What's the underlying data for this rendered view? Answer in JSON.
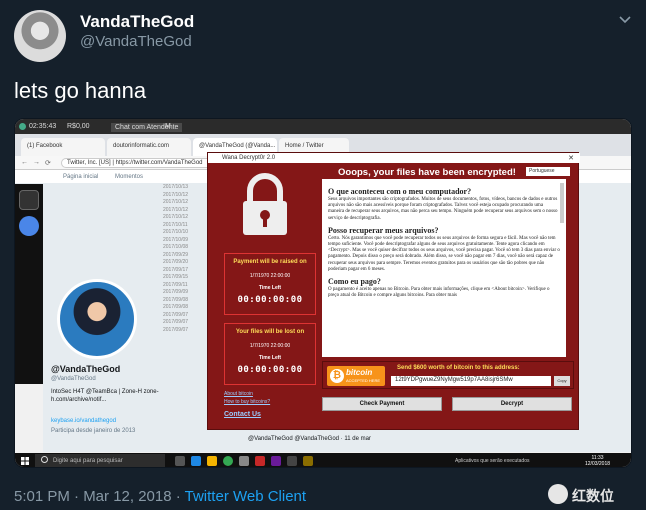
{
  "tweet": {
    "display_name": "VandaTheGod",
    "handle": "@VandaTheGod",
    "text": "lets go hanna",
    "timestamp": "5:01 PM · Mar 12, 2018 · ",
    "client": "Twitter Web Client",
    "watermark_text": "红数位"
  },
  "screenshot": {
    "topbar": {
      "time": "02:35:43",
      "price": "R$0,00",
      "tab1": "Chat com Atendente",
      "tab2": "M"
    },
    "browser_tabs": [
      "(1) Facebook",
      "doutorinformatic.com",
      "@VandaTheGod (@Vanda...",
      "Home / Twitter"
    ],
    "url": "Twitter, Inc. [US] | https://twitter.com/VandaTheGod",
    "twitter_nav": {
      "home": "Página inicial",
      "moments": "Momentos"
    },
    "dates": [
      "2017/10/13",
      "2017/10/12",
      "2017/10/12",
      "2017/10/12",
      "2017/10/12",
      "2017/10/11",
      "2017/10/10",
      "2017/10/09",
      "2017/10/08",
      "2017/09/29",
      "2017/09/20",
      "2017/09/17",
      "2017/09/15",
      "2017/09/11",
      "2017/09/09",
      "2017/09/08",
      "2017/09/08",
      "2017/09/07",
      "2017/09/07",
      "2017/09/07"
    ],
    "vanda_col": "Vanda",
    "profile": {
      "name": "@VandaTheGod",
      "handle": "@VandaTheGod",
      "bio": "IntoSec H4T @TeamBca | Zone-H zone-h.com/archive/notif...",
      "link": "keybase.io/vandathegod",
      "joined": "Participa desde janeiro de 2013"
    },
    "bottom_tweet": "@VandaTheGod @VandaTheGod · 11 de mar"
  },
  "wannacry": {
    "title": "Wana Decrypt0r 2.0",
    "close": "✕",
    "heading": "Ooops, your files have been encrypted!",
    "language": "Portuguese",
    "raise_box": {
      "title": "Payment will be raised on",
      "date": "1/7/1970 22:00:00",
      "left_label": "Time Left",
      "timer": "00:00:00:00"
    },
    "lost_box": {
      "title": "Your files will be lost on",
      "date": "1/7/1970 22:00:00",
      "left_label": "Time Left",
      "timer": "00:00:00:00"
    },
    "links": {
      "about": "About bitcoin",
      "how": "How to buy bitcoins?",
      "contact": "Contact Us"
    },
    "doc": {
      "h1": "O que aconteceu com o meu computador?",
      "p1": "Seus arquivos importantes são criptografados. Muitos de seus documentos, fotos, vídeos, bancos de dados e outros arquivos não são mais acessíveis porque foram criptografados. Talvez você esteja ocupado procurando uma maneira de recuperar seus arquivos, mas não perca seu tempo. Ninguém pode recuperar seus arquivos sem o nosso serviço de descriptografia.",
      "h2": "Posso recuperar meus arquivos?",
      "p2": "Certo. Nós garantimos que você pode recuperar todos os seus arquivos de forma segura e fácil. Mas você não tem tempo suficiente. Você pode descriptografar alguns de seus arquivos gratuitamente. Tente agora clicando em <Decrypt>. Mas se você quiser decifrar todos os seus arquivos, você precisa pagar. Você só tem 3 dias para enviar o pagamento. Depois disso o preço será dobrado. Além disso, se você não pagar em 7 dias, você não será capaz de recuperar seus arquivos para sempre. Teremos eventos gratuitos para os usuários que são tão pobres que não poderiam pagar em 6 meses.",
      "h3": "Como eu pago?",
      "p3": "O pagamento é aceito apenas no Bitcoin. Para obter mais informações, clique em <About bitcoin>. Verifique o preço atual do Bitcoin e compre alguns bitcoins. Para obter mais"
    },
    "payment": {
      "btc_word": "bitcoin",
      "btc_accepted": "ACCEPTED HERE",
      "send_text": "Send $600 worth of bitcoin to this address:",
      "address": "12t9YDPgwueZ9NyMgw519p7AA8isjr6SMw",
      "copy": "Copy"
    },
    "buttons": {
      "check": "Check Payment",
      "decrypt": "Decrypt"
    }
  },
  "taskbar": {
    "search_placeholder": "Digite aqui para pesquisar",
    "tray": "Aplicativos que serão executados",
    "time": "11:33",
    "date": "12/03/2018"
  }
}
